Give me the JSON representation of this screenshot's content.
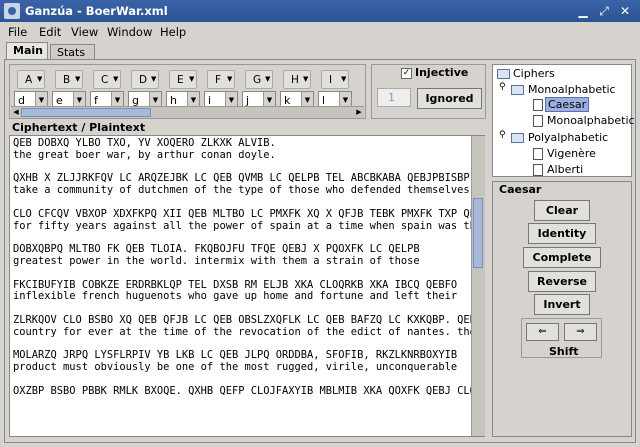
{
  "window": {
    "title": "Ganzúa - BoerWar.xml"
  },
  "menu": [
    "File",
    "Edit",
    "View",
    "Window",
    "Help"
  ],
  "tabs": [
    {
      "label": "Main",
      "active": true
    },
    {
      "label": "Stats",
      "active": false
    }
  ],
  "key": {
    "letters": [
      "A",
      "B",
      "C",
      "D",
      "E",
      "F",
      "G",
      "H",
      "I"
    ],
    "mapping": [
      "d",
      "e",
      "f",
      "g",
      "h",
      "i",
      "j",
      "k",
      "l"
    ]
  },
  "injective": {
    "label": "Injective",
    "checked": true,
    "spinner_value": "1",
    "ignored_label": "Ignored"
  },
  "ciphertext": {
    "label": "Ciphertext / Plaintext",
    "lines": [
      "QEB DOBXQ YLBO TXO, YV XOQERO ZLKXK ALVIB.",
      "the great boer war, by arthur conan doyle.",
      "",
      "QXHB X ZLJJRKFQV LC ARQZEJBK LC QEB QVMB LC QELPB TEL ABCBKABA QEBJPBISBP",
      "take a community of dutchmen of the type of those who defended themselves",
      "",
      "CLO CFCQV VBXOP XDXFKPQ XII QEB MLTBO LC PMXFK XQ X QFJB TEBK PMXFK TXP QEB",
      "for fifty years against all the power of spain at a time when spain was the",
      "",
      "DOBXQBPQ MLTBO FK QEB TLOIA. FKQBOJFU TFQE QEBJ X PQOXFK LC QELPB",
      "greatest power in the world. intermix with them a strain of those",
      "",
      "FKCIBUFYIB COBKZE ERDRBKLQP TEL DXSB RM ELJB XKA CLOQRKB XKA IBCQ QEBFO",
      "inflexible french huguenots who gave up home and fortune and left their",
      "",
      "ZLRKQOV CLO BSBO XQ QEB QFJB LC QEB OBSLZXQFLK LC QEB BAFZQ LC KXKQBP. QEB",
      "country for ever at the time of the revocation of the edict of nantes. the",
      "",
      "MOLARZQ JRPQ LYSFLRPIV YB LKB LC QEB JLPQ ORDDBA, SFOFIB, RKZLKNRBOXYIB",
      "product must obviously be one of the most rugged, virile, unconquerable",
      "",
      "OXZBP BSBO PBBK RMLK BXOQE. QXHB QEFP CLOJFAXYIB MBLMIB XKA QOXFK QEBJ CLO"
    ]
  },
  "tree": {
    "root": "Ciphers",
    "groups": [
      {
        "name": "Monoalphabetic",
        "items": [
          "Caesar",
          "Monoalphabetic"
        ]
      },
      {
        "name": "Polyalphabetic",
        "items": [
          "Vigenère",
          "Alberti"
        ]
      }
    ],
    "selected": "Caesar"
  },
  "controls": {
    "title": "Caesar",
    "buttons": [
      "Clear",
      "Identity",
      "Complete",
      "Reverse",
      "Invert"
    ],
    "shift_label": "Shift",
    "shift_left": "⇐",
    "shift_right": "⇒"
  }
}
